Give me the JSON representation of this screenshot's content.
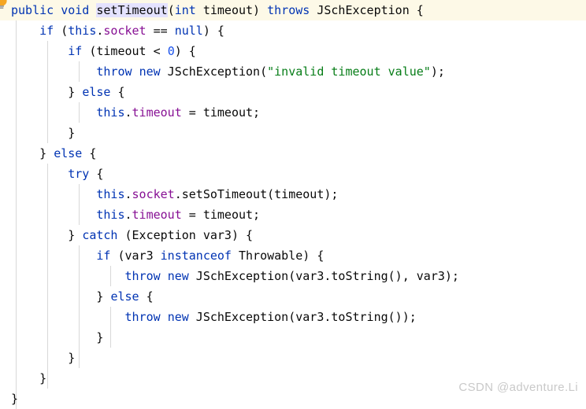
{
  "editor": {
    "language": "java",
    "background": "#ffffff",
    "current_line_background": "#fdf9e7",
    "selection_background": "#e4e2ff",
    "indent_guide_color": "#d8d8d8",
    "colors": {
      "keyword": "#0033b3",
      "number": "#1750eb",
      "string": "#067d17",
      "field": "#871094",
      "plain": "#080808",
      "bulb": "#f5a623"
    }
  },
  "gutter": {
    "bulb_icon": "lightbulb-icon"
  },
  "watermark": {
    "text": "CSDN @adventure.Li"
  },
  "code": {
    "lines": [
      {
        "indent": 0,
        "current": true,
        "tokens": [
          {
            "t": "public",
            "c": "kw"
          },
          {
            "t": " "
          },
          {
            "t": "void",
            "c": "kw"
          },
          {
            "t": " "
          },
          {
            "t": "setTimeout",
            "c": "plain sel"
          },
          {
            "t": "("
          },
          {
            "t": "int",
            "c": "kw"
          },
          {
            "t": " timeout) "
          },
          {
            "t": "throws",
            "c": "kw"
          },
          {
            "t": " JSchException {"
          }
        ]
      },
      {
        "indent": 1,
        "tokens": [
          {
            "t": "if",
            "c": "kw"
          },
          {
            "t": " ("
          },
          {
            "t": "this",
            "c": "kw"
          },
          {
            "t": "."
          },
          {
            "t": "socket",
            "c": "fld"
          },
          {
            "t": " == "
          },
          {
            "t": "null",
            "c": "kw"
          },
          {
            "t": ") {"
          }
        ]
      },
      {
        "indent": 2,
        "tokens": [
          {
            "t": "if",
            "c": "kw"
          },
          {
            "t": " (timeout < "
          },
          {
            "t": "0",
            "c": "num"
          },
          {
            "t": ") {"
          }
        ]
      },
      {
        "indent": 3,
        "tokens": [
          {
            "t": "throw",
            "c": "kw"
          },
          {
            "t": " "
          },
          {
            "t": "new",
            "c": "kw"
          },
          {
            "t": " JSchException("
          },
          {
            "t": "\"invalid timeout value\"",
            "c": "str"
          },
          {
            "t": ");"
          }
        ]
      },
      {
        "indent": 2,
        "tokens": [
          {
            "t": "} "
          },
          {
            "t": "else",
            "c": "kw"
          },
          {
            "t": " {"
          }
        ]
      },
      {
        "indent": 3,
        "tokens": [
          {
            "t": "this",
            "c": "kw"
          },
          {
            "t": "."
          },
          {
            "t": "timeout",
            "c": "fld"
          },
          {
            "t": " = timeout;"
          }
        ]
      },
      {
        "indent": 2,
        "tokens": [
          {
            "t": "}"
          }
        ]
      },
      {
        "indent": 1,
        "tokens": [
          {
            "t": "} "
          },
          {
            "t": "else",
            "c": "kw"
          },
          {
            "t": " {"
          }
        ]
      },
      {
        "indent": 2,
        "tokens": [
          {
            "t": "try",
            "c": "kw"
          },
          {
            "t": " {"
          }
        ]
      },
      {
        "indent": 3,
        "tokens": [
          {
            "t": "this",
            "c": "kw"
          },
          {
            "t": "."
          },
          {
            "t": "socket",
            "c": "fld"
          },
          {
            "t": ".setSoTimeout(timeout);"
          }
        ]
      },
      {
        "indent": 3,
        "tokens": [
          {
            "t": "this",
            "c": "kw"
          },
          {
            "t": "."
          },
          {
            "t": "timeout",
            "c": "fld"
          },
          {
            "t": " = timeout;"
          }
        ]
      },
      {
        "indent": 2,
        "tokens": [
          {
            "t": "} "
          },
          {
            "t": "catch",
            "c": "kw"
          },
          {
            "t": " (Exception var3) {"
          }
        ]
      },
      {
        "indent": 3,
        "tokens": [
          {
            "t": "if",
            "c": "kw"
          },
          {
            "t": " (var3 "
          },
          {
            "t": "instanceof",
            "c": "kw"
          },
          {
            "t": " Throwable) {"
          }
        ]
      },
      {
        "indent": 4,
        "tokens": [
          {
            "t": "throw",
            "c": "kw"
          },
          {
            "t": " "
          },
          {
            "t": "new",
            "c": "kw"
          },
          {
            "t": " JSchException(var3.toString(), var3);"
          }
        ]
      },
      {
        "indent": 3,
        "tokens": [
          {
            "t": "} "
          },
          {
            "t": "else",
            "c": "kw"
          },
          {
            "t": " {"
          }
        ]
      },
      {
        "indent": 4,
        "tokens": [
          {
            "t": "throw",
            "c": "kw"
          },
          {
            "t": " "
          },
          {
            "t": "new",
            "c": "kw"
          },
          {
            "t": " JSchException(var3.toString());"
          }
        ]
      },
      {
        "indent": 3,
        "tokens": [
          {
            "t": "}"
          }
        ]
      },
      {
        "indent": 2,
        "tokens": [
          {
            "t": "}"
          }
        ]
      },
      {
        "indent": 1,
        "tokens": [
          {
            "t": "}"
          }
        ]
      },
      {
        "indent": 0,
        "tokens": [
          {
            "t": "}"
          }
        ]
      }
    ],
    "indent_guides": [
      {
        "level": 1,
        "from_line": 1,
        "to_line": 19
      },
      {
        "level": 2,
        "from_line": 2,
        "to_line": 6
      },
      {
        "level": 3,
        "from_line": 3,
        "to_line": 3
      },
      {
        "level": 3,
        "from_line": 5,
        "to_line": 5
      },
      {
        "level": 2,
        "from_line": 8,
        "to_line": 18
      },
      {
        "level": 3,
        "from_line": 9,
        "to_line": 10
      },
      {
        "level": 3,
        "from_line": 12,
        "to_line": 17
      },
      {
        "level": 4,
        "from_line": 13,
        "to_line": 13
      },
      {
        "level": 4,
        "from_line": 15,
        "to_line": 16
      }
    ]
  }
}
